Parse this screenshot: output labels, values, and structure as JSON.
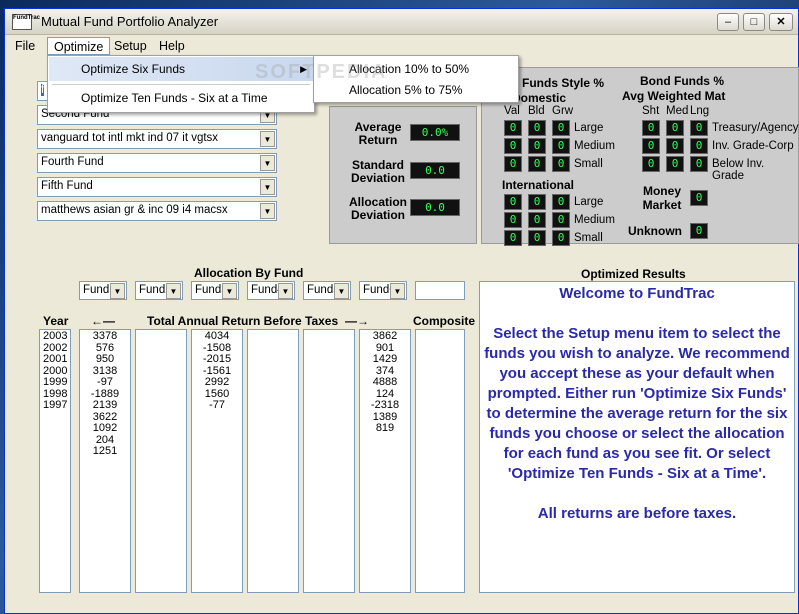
{
  "window": {
    "title": "Mutual Fund Portfolio Analyzer",
    "app_icon_text": "FundTrac"
  },
  "menu": {
    "items": [
      "File",
      "Optimize",
      "Setup",
      "Help"
    ],
    "optimize_submenu": [
      "Optimize Six Funds",
      "Optimize Ten Funds - Six at a Time"
    ],
    "six_funds_submenu": [
      "Allocation 10% to 50%",
      "Allocation 5% to 75%"
    ]
  },
  "funds": {
    "first_partial": "f",
    "list": [
      "Second Fund",
      "vanguard tot intl mkt ind 07 it vgtsx",
      "Fourth Fund",
      "Fifth Fund",
      "matthews asian gr & inc 09 i4 macsx"
    ]
  },
  "stats": {
    "average_return_label": "Average Return",
    "average_return_value": "0.0%",
    "std_dev_label": "Standard Deviation",
    "std_dev_value": "0.0",
    "alloc_dev_label": "Allocation Deviation",
    "alloc_dev_value": "0.0"
  },
  "style": {
    "stock_title": "Funds Style %",
    "domestic_label": "Domestic",
    "cols": [
      "Val",
      "Bld",
      "Grw"
    ],
    "rows": [
      "Large",
      "Medium",
      "Small"
    ],
    "international_label": "International",
    "bond_title": "Bond Funds %",
    "bond_subtitle": "Avg Weighted Mat",
    "bond_cols": [
      "Sht",
      "Med",
      "Lng"
    ],
    "bond_rows": [
      "Treasury/Agency",
      "Inv. Grade-Corp",
      "Below Inv. Grade"
    ],
    "money_market_label": "Money Market",
    "unknown_label": "Unknown",
    "zero": "0"
  },
  "allocation": {
    "title": "Allocation By Fund",
    "fund_selectors": [
      "Fund1",
      "Fund2",
      "Fund3",
      "Fund4",
      "Fund5",
      "Fund6"
    ]
  },
  "returns": {
    "year_header": "Year",
    "header": "Total Annual Return Before Taxes",
    "composite_header": "Composite",
    "years": [
      "2003",
      "2002",
      "2001",
      "2000",
      "1999",
      "1998",
      "1997"
    ],
    "fund1": [
      "3378",
      "576",
      "950",
      "3138",
      "-97",
      "-1889",
      "2139",
      "3622",
      "1092",
      "204",
      "1251"
    ],
    "fund3": [
      "4034",
      "-1508",
      "-2015",
      "-1561",
      "2992",
      "1560",
      "-77"
    ],
    "fund6": [
      "3862",
      "901",
      "1429",
      "374",
      "4888",
      "124",
      "-2318",
      "1389",
      "819"
    ]
  },
  "results": {
    "title": "Optimized Results",
    "welcome": "Welcome to FundTrac",
    "body": "Select the Setup menu item to select the funds you wish to analyze. We recommend you accept these as your default when prompted. Either run 'Optimize Six Funds' to determine the average return for the six funds you choose or select the allocation for each fund as you see fit. Or select 'Optimize Ten Funds - Six at a Time'.",
    "footer": "All returns are before taxes."
  },
  "watermark": "SOFTPEDIA"
}
